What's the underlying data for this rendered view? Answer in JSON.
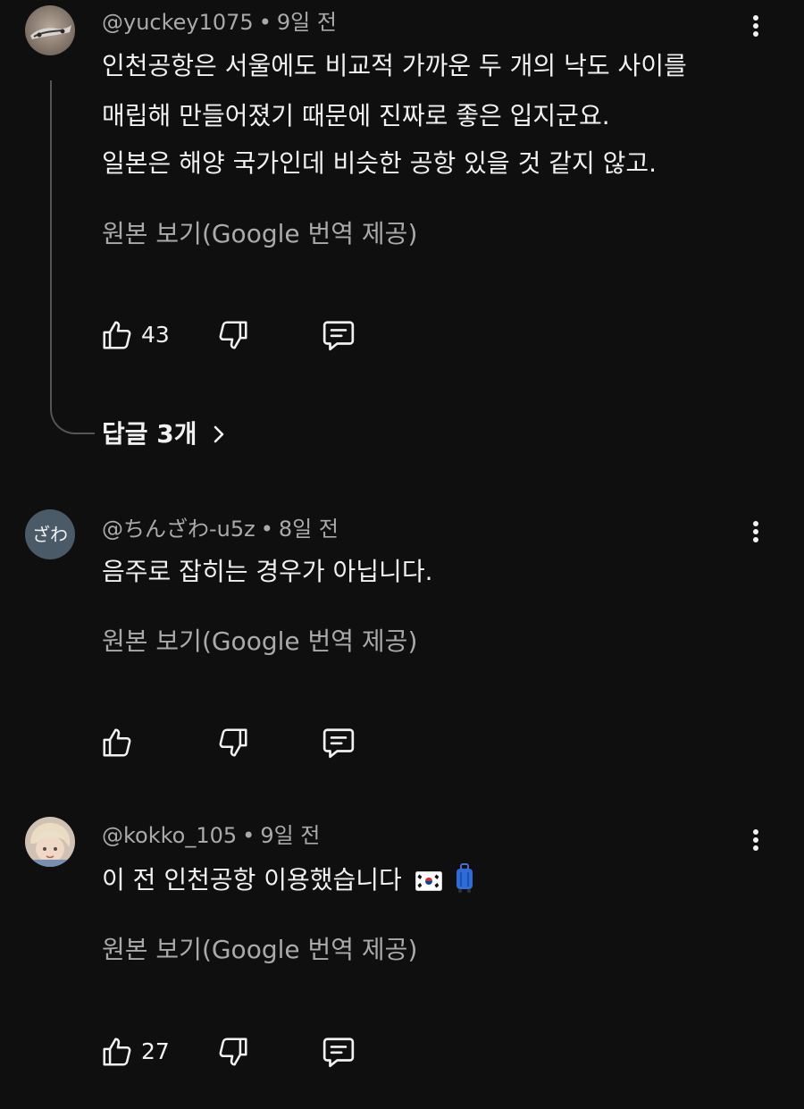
{
  "comments": [
    {
      "username": "@yuckey1075",
      "separator": "•",
      "time": "9일 전",
      "lines": [
        "인천공항은 서울에도 비교적 가까운 두 개의 낙도 사이를",
        "매립해 만들어졌기 때문에 진짜로 좋은 입지군요.",
        "일본은 해양 국가인데 비슷한 공항 있을 것 같지 않고."
      ],
      "translate_label": "원본 보기(Google 번역 제공)",
      "likes": "43",
      "replies_label": "답글 3개"
    },
    {
      "username": "@ちんざわ-u5z",
      "separator": "•",
      "time": "8일 전",
      "avatar_text": "ざわ",
      "lines": [
        "음주로 잡히는 경우가 아닙니다."
      ],
      "translate_label": "원본 보기(Google 번역 제공)",
      "likes": ""
    },
    {
      "username": "@kokko_105",
      "separator": "•",
      "time": "9일 전",
      "lines": [
        "이 전 인천공항 이용했습니다"
      ],
      "translate_label": "원본 보기(Google 번역 제공)",
      "likes": "27"
    }
  ],
  "icons": {
    "like": "thumbs-up-icon",
    "dislike": "thumbs-down-icon",
    "reply": "comment-reply-icon",
    "more": "more-vertical-icon",
    "chevron": "chevron-right-icon"
  },
  "colors": {
    "background": "#0f0f0f",
    "text": "#f1f1f1",
    "secondary_text": "#aaaaaa",
    "zawa_avatar": "#4a5a66"
  }
}
